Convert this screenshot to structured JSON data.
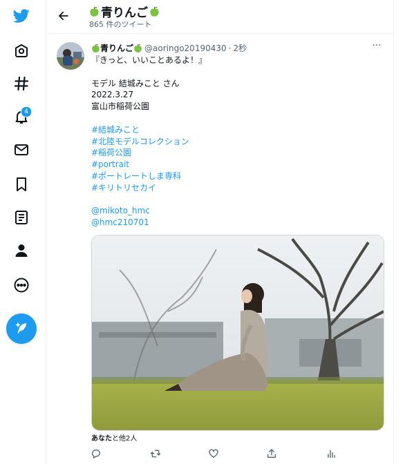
{
  "profile": {
    "name": "青りんご",
    "tweet_count": "865 件のツイート"
  },
  "sidebar": {
    "notification_badge": "4"
  },
  "tweet": {
    "display_name": "青りんご",
    "handle": "@aoringo20190430",
    "separator": "·",
    "time": "2秒",
    "more": "···",
    "lines": [
      "『きっと、いいことあるよ！』",
      "",
      "モデル 結城みこと さん",
      "2022.3.27",
      "富山市稲荷公園",
      ""
    ],
    "hashtags": [
      "#結城みこと",
      "#北陸モデルコレクション",
      "#稲荷公園",
      "#portrait",
      "#ポートレートしま専科",
      "#キリトリセカイ"
    ],
    "mentions": [
      "@mikoto_hmc",
      "@hmc210701"
    ],
    "liked_by_user": "あなた",
    "liked_by_rest": "と他2人"
  },
  "icons": {
    "logo": "twitter-bird-icon",
    "home": "home-icon",
    "explore": "hashtag-icon",
    "notifications": "bell-icon",
    "messages": "envelope-icon",
    "bookmarks": "bookmark-icon",
    "lists": "list-icon",
    "profile": "person-icon",
    "more": "more-circle-icon",
    "compose": "feather-plus-icon"
  },
  "colors": {
    "accent": "#1d9bf0",
    "text": "#0f1419",
    "secondary": "#536471"
  }
}
